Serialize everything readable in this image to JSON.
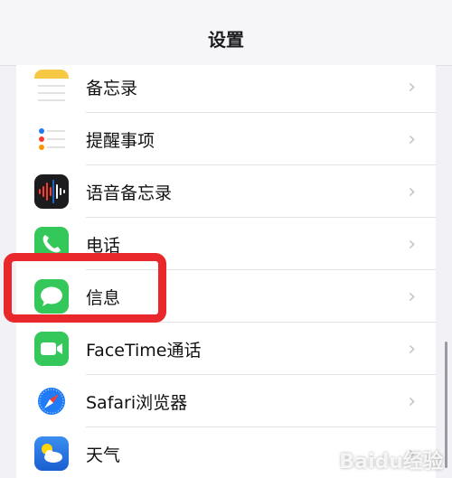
{
  "nav": {
    "title": "设置"
  },
  "rows": [
    {
      "label": "备忘录",
      "icon": "notes-icon"
    },
    {
      "label": "提醒事项",
      "icon": "reminders-icon"
    },
    {
      "label": "语音备忘录",
      "icon": "voice-memos-icon"
    },
    {
      "label": "电话",
      "icon": "phone-icon"
    },
    {
      "label": "信息",
      "icon": "messages-icon"
    },
    {
      "label": "FaceTime通话",
      "icon": "facetime-icon"
    },
    {
      "label": "Safari浏览器",
      "icon": "safari-icon"
    },
    {
      "label": "天气",
      "icon": "weather-icon"
    }
  ],
  "chevron": "›",
  "watermark": "Baidu经验",
  "colors": {
    "highlight": "#e8282b",
    "green": "#34c759",
    "blue": "#1f7cf6"
  }
}
